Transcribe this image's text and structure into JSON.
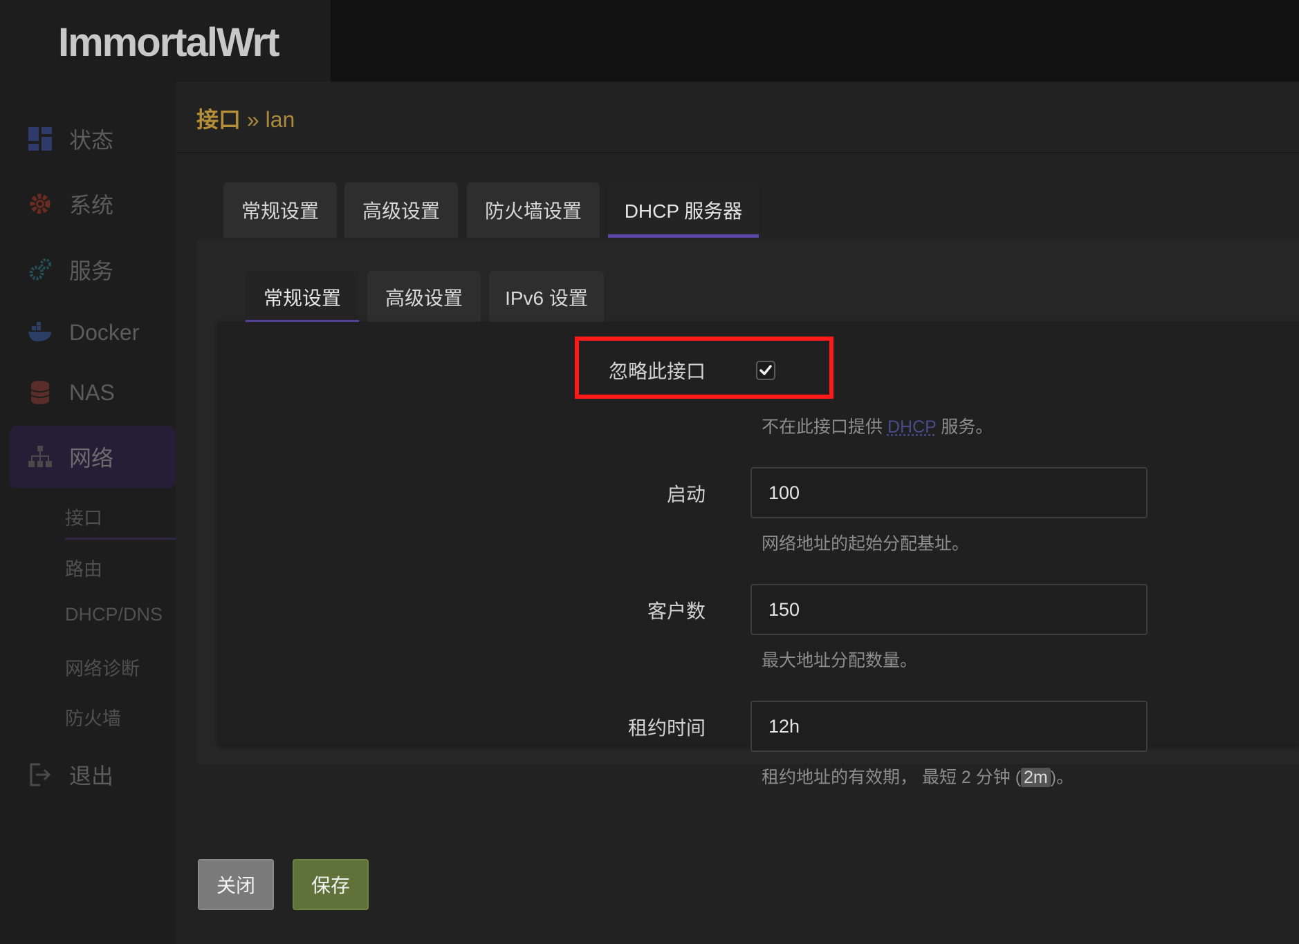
{
  "brand": "ImmortalWrt",
  "sidebar": {
    "items": [
      {
        "label": "状态",
        "icon": "dashboard-icon"
      },
      {
        "label": "系统",
        "icon": "gear-icon"
      },
      {
        "label": "服务",
        "icon": "cogs-icon"
      },
      {
        "label": "Docker",
        "icon": "docker-icon"
      },
      {
        "label": "NAS",
        "icon": "database-icon"
      },
      {
        "label": "网络",
        "icon": "network-icon"
      },
      {
        "label": "退出",
        "icon": "logout-icon"
      }
    ],
    "sub_items": [
      "接口",
      "路由",
      "DHCP/DNS",
      "网络诊断",
      "防火墙"
    ]
  },
  "breadcrumb": {
    "parent": "接口",
    "separator": "»",
    "current": "lan"
  },
  "tabs": [
    "常规设置",
    "高级设置",
    "防火墙设置",
    "DHCP 服务器"
  ],
  "subtabs": [
    "常规设置",
    "高级设置",
    "IPv6 设置"
  ],
  "form": {
    "ignore": {
      "label": "忽略此接口",
      "checked": true,
      "hint_pre": "不在此接口提供",
      "hint_abbr": "DHCP",
      "hint_post": "服务。"
    },
    "start": {
      "label": "启动",
      "value": "100",
      "hint": "网络地址的起始分配基址。"
    },
    "limit": {
      "label": "客户数",
      "value": "150",
      "hint": "最大地址分配数量。"
    },
    "leasetime": {
      "label": "租约时间",
      "value": "12h",
      "hint_pre": "租约地址的有效期， 最短 2 分钟 (",
      "hint_code": "2m",
      "hint_post": ")。"
    }
  },
  "buttons": {
    "close": "关闭",
    "save": "保存"
  },
  "colors": {
    "accent": "#5a45a6",
    "highlight": "#ff1a1a",
    "save": "#5f7239"
  }
}
